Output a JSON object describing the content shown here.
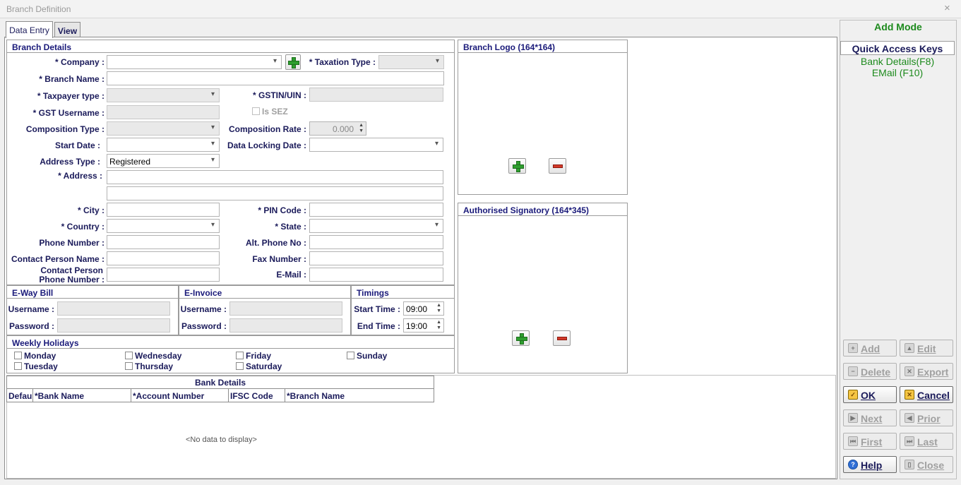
{
  "window": {
    "title": "Branch Definition",
    "close": "×"
  },
  "tabs": [
    {
      "label": "Data Entry"
    },
    {
      "label": "View"
    }
  ],
  "branch_details": {
    "title": "Branch Details",
    "company_label": "* Company :",
    "taxation_type_label": "* Taxation Type :",
    "branch_name_label": "* Branch Name :",
    "taxpayer_type_label": "* Taxpayer type :",
    "gstin_label": "* GSTIN/UIN :",
    "gst_username_label": "* GST Username :",
    "is_sez_label": "Is SEZ",
    "composition_type_label": "Composition Type :",
    "composition_rate_label": "Composition Rate :",
    "composition_rate_value": "0.000",
    "start_date_label": "Start Date :",
    "data_locking_label": "Data Locking Date :",
    "address_type_label": "Address Type :",
    "address_type_value": "Registered",
    "address_label": "* Address :",
    "city_label": "* City :",
    "pin_label": "* PIN Code :",
    "country_label": "* Country :",
    "state_label": "* State :",
    "phone_label": "Phone Number :",
    "alt_phone_label": "Alt. Phone No :",
    "contact_person_label": "Contact Person Name :",
    "fax_label": "Fax Number :",
    "contact_phone_label_1": "Contact Person",
    "contact_phone_label_2": "Phone Number :",
    "email_label": "E-Mail :"
  },
  "eway": {
    "title": "E-Way Bill",
    "username_label": "Username :",
    "password_label": "Password :"
  },
  "einvoice": {
    "title": "E-Invoice",
    "username_label": "Username :",
    "password_label": "Password :"
  },
  "timings": {
    "title": "Timings",
    "start_label": "Start Time :",
    "start_value": "09:00",
    "end_label": "End Time :",
    "end_value": "19:00"
  },
  "holidays": {
    "title": "Weekly Holidays",
    "days": [
      "Monday",
      "Wednesday",
      "Friday",
      "Sunday",
      "Tuesday",
      "Thursday",
      "Saturday"
    ]
  },
  "branch_logo": {
    "title": "Branch Logo (164*164)"
  },
  "signatory": {
    "title": "Authorised Signatory (164*345)"
  },
  "bank_details": {
    "title": "Bank Details",
    "columns": [
      "Defau",
      "*Bank Name",
      "*Account Number",
      "IFSC Code",
      "*Branch Name"
    ],
    "empty_text": "<No data to display>"
  },
  "right_panel": {
    "mode": "Add Mode",
    "quick_keys_title": "Quick Access Keys",
    "keys": [
      "Bank Details(F8)",
      "EMail (F10)"
    ],
    "buttons": {
      "add": "Add",
      "edit": "Edit",
      "delete": "Delete",
      "export": "Export",
      "ok": "OK",
      "cancel": "Cancel",
      "next": "Next",
      "prior": "Prior",
      "first": "First",
      "last": "Last",
      "help": "Help",
      "close": "Close"
    }
  },
  "colors": {
    "label": "#1a1a5a",
    "accent_green": "#1d8a1d",
    "plus_green": "#2e9e2e",
    "minus_red": "#d23a2a"
  }
}
